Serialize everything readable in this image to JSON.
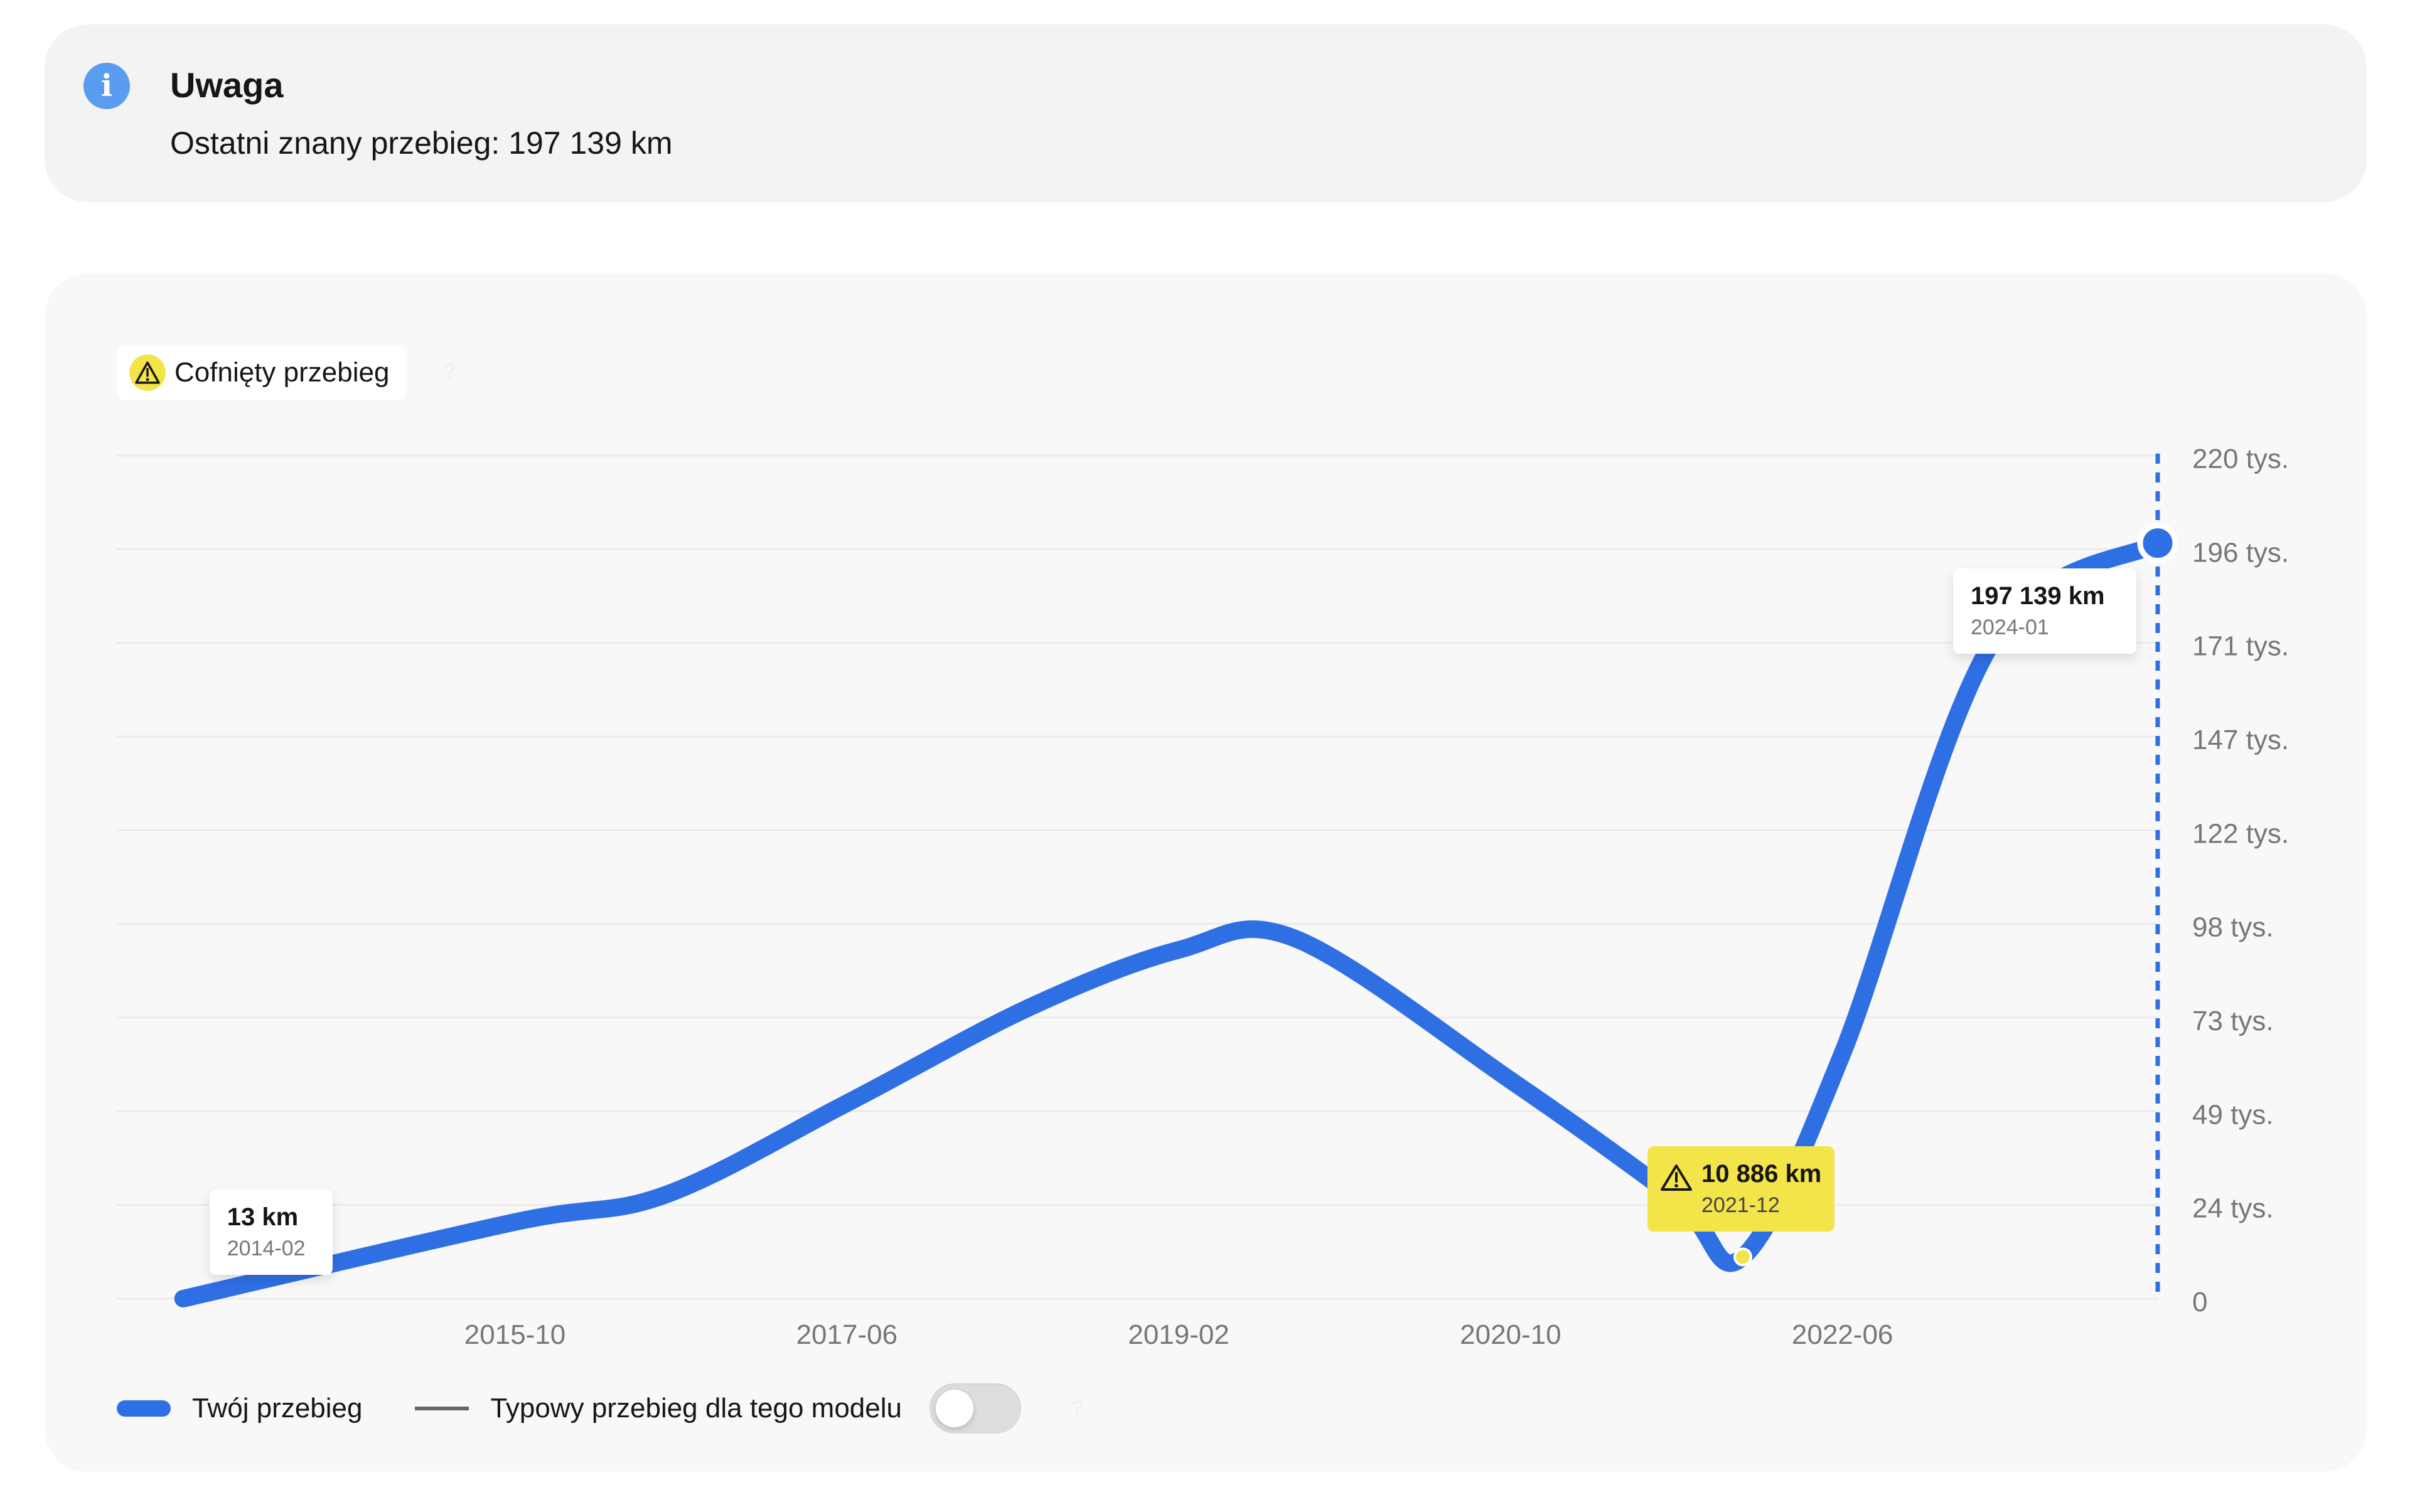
{
  "notice": {
    "title": "Uwaga",
    "text": "Ostatni znany przebieg: 197 139 km",
    "icon": "info-icon",
    "icon_glyph": "i",
    "icon_color": "#5a9cf0"
  },
  "chart_badges": {
    "rollback": "Cofnięty przebieg",
    "rollback_icon": "warning-icon",
    "rollback_color": "#f3e44a",
    "help_glyph": "?"
  },
  "chart_data": {
    "type": "line",
    "title": "",
    "xlabel": "",
    "ylabel": "",
    "x_unit": "year-month",
    "x_ticks": [
      "2015-10",
      "2017-06",
      "2019-02",
      "2020-10",
      "2022-06"
    ],
    "y_ticks": [
      "0",
      "24 tys.",
      "49 tys.",
      "73 tys.",
      "98 tys.",
      "122 tys.",
      "147 tys.",
      "171 tys.",
      "196 tys.",
      "220 tys."
    ],
    "ylim": [
      0,
      220000
    ],
    "series": [
      {
        "name": "Twój przebieg",
        "color": "#2f6fe4",
        "points": [
          {
            "x": "2014-02",
            "y": 13
          },
          {
            "x": "2015-10",
            "y": 20000
          },
          {
            "x": "2016-07",
            "y": 27000
          },
          {
            "x": "2017-06",
            "y": 51000
          },
          {
            "x": "2018-05",
            "y": 76000
          },
          {
            "x": "2019-02",
            "y": 91000
          },
          {
            "x": "2019-09",
            "y": 94000
          },
          {
            "x": "2020-10",
            "y": 57000
          },
          {
            "x": "2021-08",
            "y": 26000
          },
          {
            "x": "2021-12",
            "y": 10886
          },
          {
            "x": "2022-06",
            "y": 64000
          },
          {
            "x": "2023-03",
            "y": 171000
          },
          {
            "x": "2024-01",
            "y": 197139
          }
        ]
      }
    ],
    "callouts": [
      {
        "value": "13 km",
        "date": "2014-02",
        "point_index": 0,
        "style": "normal"
      },
      {
        "value": "10 886 km",
        "date": "2021-12",
        "point_index": 9,
        "style": "warning"
      },
      {
        "value": "197 139 km",
        "date": "2024-01",
        "point_index": 12,
        "style": "normal"
      }
    ],
    "current_marker": {
      "x": "2024-01",
      "color": "#2f6fe4"
    },
    "grid": true,
    "y_axis_position": "right",
    "legend_position": "bottom-left"
  },
  "legend": {
    "your_mileage": "Twój przebieg",
    "typical_mileage": "Typowy przebieg dla tego modelu",
    "typical_toggle_on": false,
    "help_glyph": "?"
  }
}
